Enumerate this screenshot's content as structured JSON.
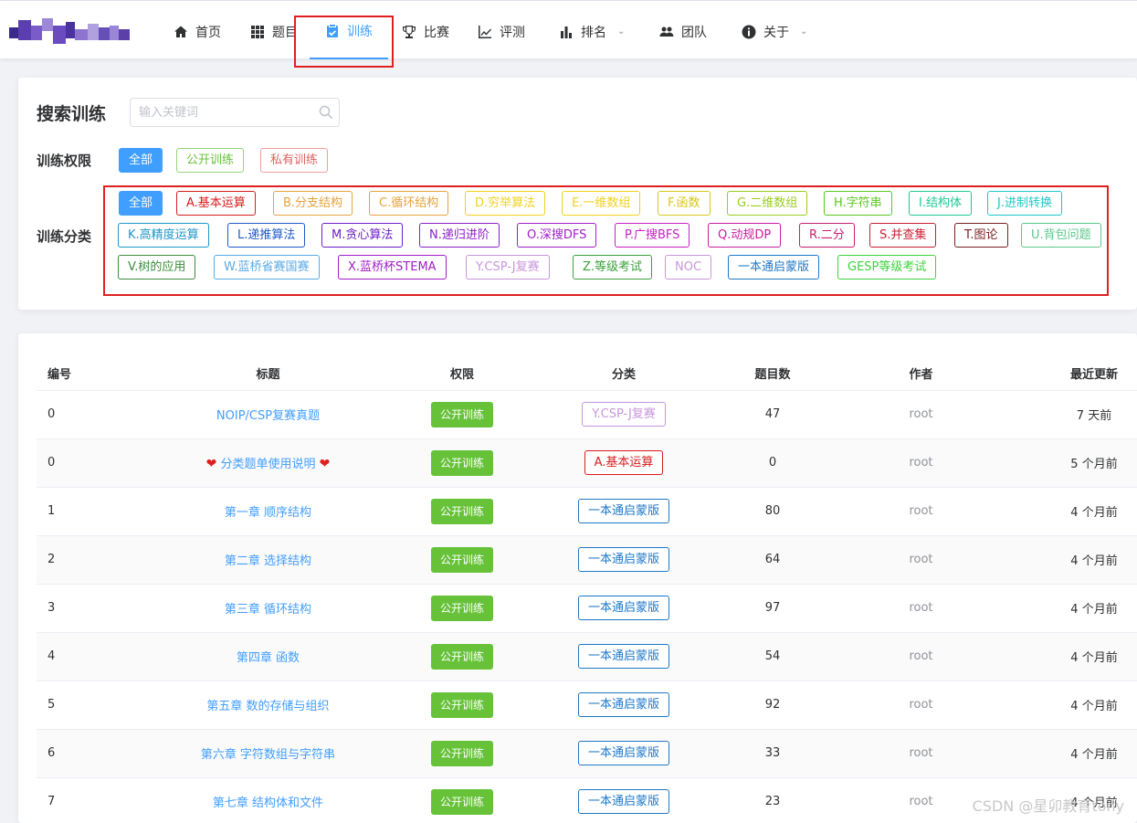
{
  "nav": {
    "items": [
      {
        "label": "首页",
        "icon": "home-icon"
      },
      {
        "label": "题目",
        "icon": "grid-icon"
      },
      {
        "label": "训练",
        "icon": "clipboard-icon",
        "active": true
      },
      {
        "label": "比赛",
        "icon": "trophy-icon"
      },
      {
        "label": "评测",
        "icon": "chart-icon"
      },
      {
        "label": "排名",
        "icon": "bar-chart-icon",
        "dropdown": true
      },
      {
        "label": "团队",
        "icon": "users-icon"
      },
      {
        "label": "关于",
        "icon": "info-icon",
        "dropdown": true
      }
    ]
  },
  "search": {
    "title": "搜索训练",
    "placeholder": "输入关键词"
  },
  "filters": {
    "auth_label": "训练权限",
    "auth_options": [
      "全部",
      "公开训练",
      "私有训练"
    ],
    "category_label": "训练分类",
    "categories": [
      {
        "name": "全部",
        "color": "#409eff"
      },
      {
        "name": "A.基本运算",
        "color": "#d71d1d"
      },
      {
        "name": "B.分支结构",
        "color": "#e6a23c"
      },
      {
        "name": "C.循环结构",
        "color": "#e6a23c"
      },
      {
        "name": "D.穷举算法",
        "color": "#f0d21e"
      },
      {
        "name": "E.一维数组",
        "color": "#f0d21e"
      },
      {
        "name": "F.函数",
        "color": "#d9c61c"
      },
      {
        "name": "G.二维数组",
        "color": "#9bcc1e"
      },
      {
        "name": "H.字符串",
        "color": "#5ac81e"
      },
      {
        "name": "I.结构体",
        "color": "#1ec894"
      },
      {
        "name": "J.进制转换",
        "color": "#1ec8c8"
      },
      {
        "name": "K.高精度运算",
        "color": "#1e96c8"
      },
      {
        "name": "L.递推算法",
        "color": "#1e5ac8"
      },
      {
        "name": "M.贪心算法",
        "color": "#6a1ec8"
      },
      {
        "name": "N.递归进阶",
        "color": "#8c1ec8"
      },
      {
        "name": "O.深搜DFS",
        "color": "#a01ec8"
      },
      {
        "name": "P.广搜BFS",
        "color": "#c81ec8"
      },
      {
        "name": "Q.动规DP",
        "color": "#c81ea0"
      },
      {
        "name": "R.二分",
        "color": "#c81e6e"
      },
      {
        "name": "S.并查集",
        "color": "#c81e32"
      },
      {
        "name": "T.图论",
        "color": "#7a1e1e"
      },
      {
        "name": "U.背包问题",
        "color": "#5ac88c"
      },
      {
        "name": "V.树的应用",
        "color": "#3c8c3c"
      },
      {
        "name": "W.蓝桥省赛国赛",
        "color": "#5aaae6"
      },
      {
        "name": "X.蓝桥杯STEMA",
        "color": "#a01ec8"
      },
      {
        "name": "Y.CSP-J复赛",
        "color": "#c896dc"
      },
      {
        "name": "Z.等级考试",
        "color": "#3ca03c"
      },
      {
        "name": "NOC",
        "color": "#c896dc"
      },
      {
        "name": "一本通启蒙版",
        "color": "#1e78c8"
      },
      {
        "name": "GESP等级考试",
        "color": "#3cd23c"
      }
    ]
  },
  "table": {
    "headers": [
      "编号",
      "标题",
      "权限",
      "分类",
      "题目数",
      "作者",
      "最近更新"
    ],
    "rows": [
      {
        "id": "0",
        "title": "NOIP/CSP复赛真题",
        "perm": "公开训练",
        "category": "Y.CSP-J复赛",
        "cat_color": "#c896dc",
        "count": "47",
        "author": "root",
        "updated": "7 天前"
      },
      {
        "id": "0",
        "title": "分类题单使用说明",
        "hearts": true,
        "perm": "公开训练",
        "category": "A.基本运算",
        "cat_color": "#d71d1d",
        "count": "0",
        "author": "root",
        "updated": "5 个月前"
      },
      {
        "id": "1",
        "title": "第一章 顺序结构",
        "perm": "公开训练",
        "category": "一本通启蒙版",
        "cat_color": "#1e78c8",
        "count": "80",
        "author": "root",
        "updated": "4 个月前"
      },
      {
        "id": "2",
        "title": "第二章 选择结构",
        "perm": "公开训练",
        "category": "一本通启蒙版",
        "cat_color": "#1e78c8",
        "count": "64",
        "author": "root",
        "updated": "4 个月前"
      },
      {
        "id": "3",
        "title": "第三章 循环结构",
        "perm": "公开训练",
        "category": "一本通启蒙版",
        "cat_color": "#1e78c8",
        "count": "97",
        "author": "root",
        "updated": "4 个月前"
      },
      {
        "id": "4",
        "title": "第四章 函数",
        "perm": "公开训练",
        "category": "一本通启蒙版",
        "cat_color": "#1e78c8",
        "count": "54",
        "author": "root",
        "updated": "4 个月前"
      },
      {
        "id": "5",
        "title": "第五章 数的存储与组织",
        "perm": "公开训练",
        "category": "一本通启蒙版",
        "cat_color": "#1e78c8",
        "count": "92",
        "author": "root",
        "updated": "4 个月前"
      },
      {
        "id": "6",
        "title": "第六章 字符数组与字符串",
        "perm": "公开训练",
        "category": "一本通启蒙版",
        "cat_color": "#1e78c8",
        "count": "33",
        "author": "root",
        "updated": "4 个月前"
      },
      {
        "id": "7",
        "title": "第七章 结构体和文件",
        "perm": "公开训练",
        "category": "一本通启蒙版",
        "cat_color": "#1e78c8",
        "count": "23",
        "author": "root",
        "updated": "4 个月前"
      }
    ]
  },
  "watermark": "CSDN @星卯教育tony"
}
